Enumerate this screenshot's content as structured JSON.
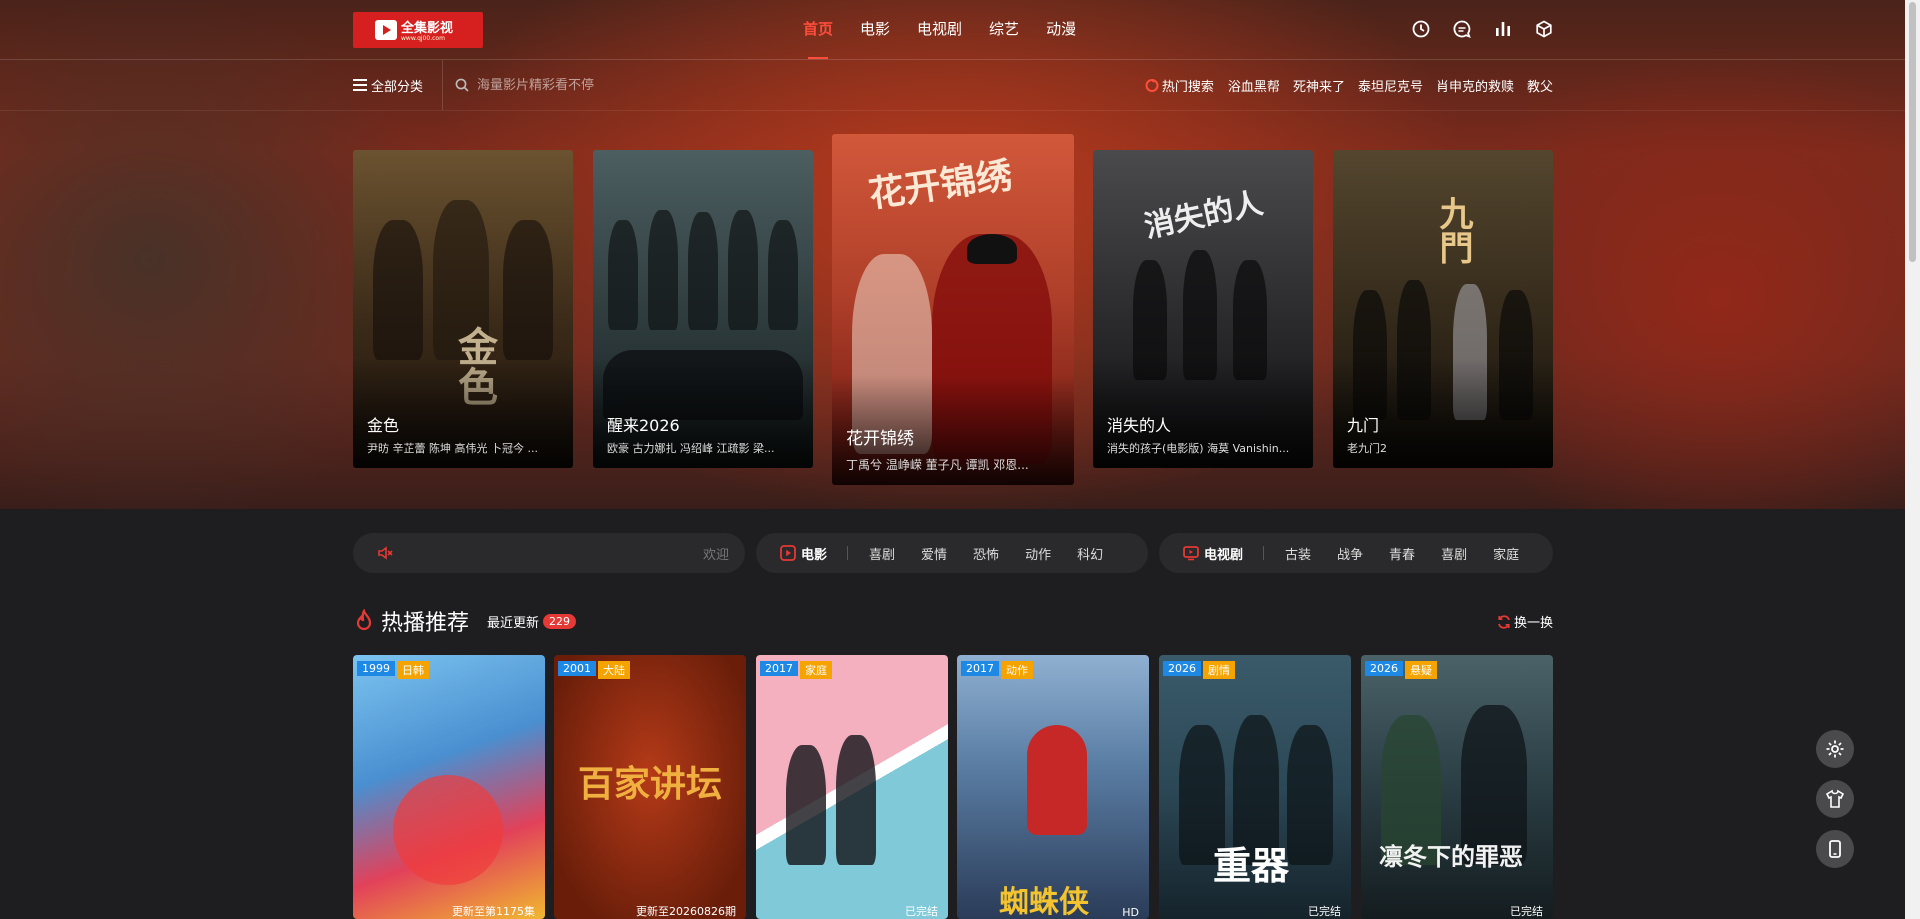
{
  "brand": {
    "logo_text": "全集影视",
    "logo_sub": "www.qj00.com"
  },
  "nav": [
    {
      "label": "首页",
      "active": true
    },
    {
      "label": "电影",
      "active": false
    },
    {
      "label": "电视剧",
      "active": false
    },
    {
      "label": "综艺",
      "active": false
    },
    {
      "label": "动漫",
      "active": false
    }
  ],
  "header_icons": [
    "history-icon",
    "message-icon",
    "chart-icon",
    "box-icon"
  ],
  "subbar": {
    "category_label": "全部分类",
    "search_placeholder": "海量影片精彩看不停",
    "hot_label": "热门搜索",
    "hot_links": [
      "浴血黑帮",
      "死神来了",
      "泰坦尼克号",
      "肖申克的救赎",
      "教父"
    ]
  },
  "carousel": [
    {
      "title": "金色",
      "cast": "尹昉 辛芷蕾 陈坤 高伟光 卜冠今 ...",
      "glyph": "金色",
      "color_top": "#5a4528",
      "color_bottom": "#1e140c"
    },
    {
      "title": "醒来2026",
      "cast": "欧豪 古力娜扎 冯绍峰 江疏影 梁...",
      "glyph": "",
      "color_top": "#3c4c4e",
      "color_bottom": "#1a2223"
    },
    {
      "title": "花开锦绣",
      "cast": "丁禹兮 温峥嵘 董子凡 谭凯 邓恩...",
      "glyph": "花开锦绣",
      "color_top": "#c8502e",
      "color_bottom": "#7a1a12"
    },
    {
      "title": "消失的人",
      "cast": "消失的孩子(电影版) 海莫 Vanishin...",
      "glyph": "消失的人",
      "color_top": "#3a3a3c",
      "color_bottom": "#141416"
    },
    {
      "title": "九门",
      "cast": "老九门2",
      "glyph": "九門",
      "color_top": "#3e3424",
      "color_bottom": "#16120c"
    }
  ],
  "category_bars": [
    {
      "title": "",
      "welcome": "欢迎",
      "links": []
    },
    {
      "title": "电影",
      "links": [
        "喜剧",
        "爱情",
        "恐怖",
        "动作",
        "科幻"
      ]
    },
    {
      "title": "电视剧",
      "links": [
        "古装",
        "战争",
        "青春",
        "喜剧",
        "家庭"
      ]
    }
  ],
  "recommend": {
    "title": "热播推荐",
    "recent_label": "最近更新",
    "recent_count": "229",
    "refresh_label": "换一换",
    "cards": [
      {
        "year": "1999",
        "category": "日韩",
        "status": "更新至第1175集",
        "art": "#5aa7e0",
        "art2": "#e2415a"
      },
      {
        "year": "2001",
        "category": "大陆",
        "status": "更新至20260826期",
        "art": "#8a2a10",
        "art2": "#b53a18",
        "glyph": "百家讲坛"
      },
      {
        "year": "2017",
        "category": "家庭",
        "status": "已完结",
        "art": "#f2a2b2",
        "art2": "#7fc9d8"
      },
      {
        "year": "2017",
        "category": "动作",
        "status": "HD",
        "art": "#5c7fa6",
        "art2": "#2a3c58",
        "glyph": "蜘蛛侠"
      },
      {
        "year": "2026",
        "category": "剧情",
        "status": "已完结",
        "art": "#2c4856",
        "art2": "#15232b",
        "glyph": "重器"
      },
      {
        "year": "2026",
        "category": "悬疑",
        "status": "已完结",
        "art": "#2a3e44",
        "art2": "#141c1f",
        "glyph": "凛冬下的罪恶"
      }
    ]
  },
  "floating_buttons": [
    "settings-icon",
    "shirt-icon",
    "mobile-icon"
  ]
}
